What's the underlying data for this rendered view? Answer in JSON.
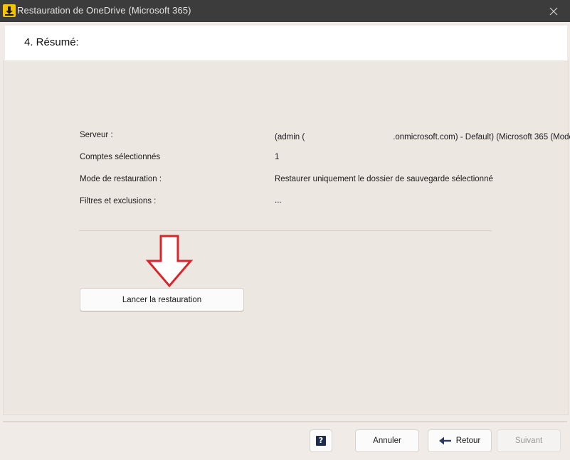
{
  "window": {
    "title": "Restauration de OneDrive (Microsoft 365)",
    "close_glyph": "✕"
  },
  "header": {
    "title": "4. Résumé:"
  },
  "summary": {
    "rows": [
      {
        "label": "Serveur :",
        "value_prefix": "(admin (",
        "value_suffix": ".onmicrosoft.com) - Default) (Microsoft 365 (Mode"
      },
      {
        "label": "Comptes sélectionnés",
        "value": "1"
      },
      {
        "label": "Mode de restauration :",
        "value": "Restaurer uniquement le dossier de sauvegarde sélectionné"
      },
      {
        "label": "Filtres et exclusions :",
        "value": "..."
      }
    ]
  },
  "actions": {
    "launch_label": "Lancer la restauration"
  },
  "footer": {
    "help_glyph": "?",
    "cancel_label": "Annuler",
    "back_label": "Retour",
    "next_label": "Suivant",
    "next_enabled": false
  },
  "colors": {
    "titlebar": "#3c3c3c",
    "background": "#f0ebe6",
    "arrow_outline": "#d9262c",
    "app_icon": "#f5c400",
    "back_arrow": "#2b3a5c"
  },
  "icons": {
    "app": "iperius-download-icon",
    "close": "close-icon",
    "annotation": "down-arrow-annotation-icon",
    "help": "help-icon",
    "back": "arrow-left-icon"
  }
}
